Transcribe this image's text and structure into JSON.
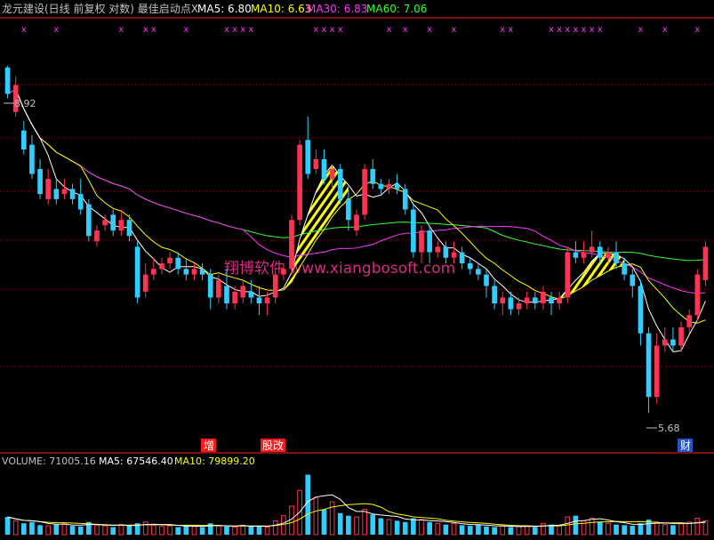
{
  "colors": {
    "background": "#000000",
    "up": "#ff3355",
    "down": "#33ccff",
    "ma5": "#ffffff",
    "ma10": "#ffff00",
    "ma30": "#ff33ff",
    "ma60": "#33ff33",
    "grid": "#a0001a",
    "border": "#ff2020",
    "hatch": "#ffff00",
    "marker": "#ff33ff",
    "watermark": "#ff3399",
    "text": "#c0c0c0",
    "label_bg": "#ff1a1a"
  },
  "header": {
    "title": "龙元建设(日线 前复权 对数) 最佳启动点X",
    "ma5_label": "MA5: 6.80",
    "ma10_label": "MA10: 6.63",
    "ma30_label": "MA30: 6.83",
    "ma60_label": "MA60: 7.06"
  },
  "volume_header": {
    "volume_label": "VOLUME: 71005.16",
    "ma5_label": "MA5: 67546.40",
    "ma10_label": "MA10: 79899.20"
  },
  "watermark": "翔博软件 www.xiangbosoft.com",
  "price_labels": {
    "high": "8.92",
    "low": "5.68"
  },
  "event_tags": [
    {
      "text": "增",
      "style": "red"
    },
    {
      "text": "股改",
      "style": "red"
    },
    {
      "text": "财",
      "style": "blue"
    }
  ],
  "chart_data": [
    {
      "type": "candlestick",
      "title": "龙元建设(日线 前复权 对数) 最佳启动点X",
      "ylim": [
        5.45,
        9.45
      ],
      "y_scale": "log",
      "annotations": {
        "high": 8.92,
        "low": 5.68
      },
      "candles": [
        [
          8.9,
          8.6,
          8.92,
          8.55
        ],
        [
          8.4,
          8.7,
          8.8,
          8.35
        ],
        [
          8.2,
          8.0,
          8.3,
          7.95
        ],
        [
          8.05,
          7.75,
          8.15,
          7.7
        ],
        [
          7.8,
          7.55,
          7.9,
          7.5
        ],
        [
          7.5,
          7.7,
          7.8,
          7.45
        ],
        [
          7.6,
          7.5,
          7.7,
          7.45
        ],
        [
          7.55,
          7.6,
          7.7,
          7.5
        ],
        [
          7.6,
          7.5,
          7.65,
          7.45
        ],
        [
          7.55,
          7.4,
          7.7,
          7.35
        ],
        [
          7.45,
          7.15,
          7.5,
          7.1
        ],
        [
          7.1,
          7.2,
          7.25,
          7.05
        ],
        [
          7.25,
          7.3,
          7.35,
          7.2
        ],
        [
          7.35,
          7.2,
          7.4,
          7.15
        ],
        [
          7.2,
          7.3,
          7.4,
          7.15
        ],
        [
          7.3,
          7.15,
          7.35,
          7.1
        ],
        [
          7.05,
          6.6,
          7.1,
          6.55
        ],
        [
          6.65,
          6.8,
          6.9,
          6.6
        ],
        [
          6.8,
          6.85,
          6.95,
          6.75
        ],
        [
          6.85,
          6.9,
          6.95,
          6.8
        ],
        [
          6.9,
          6.95,
          7.0,
          6.85
        ],
        [
          6.95,
          6.85,
          7.0,
          6.8
        ],
        [
          6.85,
          6.8,
          6.95,
          6.75
        ],
        [
          6.8,
          6.85,
          6.9,
          6.75
        ],
        [
          6.85,
          6.8,
          6.9,
          6.75
        ],
        [
          6.8,
          6.6,
          6.85,
          6.5
        ],
        [
          6.6,
          6.75,
          6.8,
          6.55
        ],
        [
          6.7,
          6.55,
          6.85,
          6.5
        ],
        [
          6.55,
          6.65,
          6.7,
          6.5
        ],
        [
          6.6,
          6.7,
          6.75,
          6.55
        ],
        [
          6.65,
          6.6,
          6.75,
          6.55
        ],
        [
          6.6,
          6.55,
          6.7,
          6.45
        ],
        [
          6.55,
          6.6,
          6.65,
          6.45
        ],
        [
          6.6,
          6.8,
          6.85,
          6.55
        ],
        [
          6.8,
          6.85,
          6.9,
          6.75
        ],
        [
          6.85,
          7.3,
          7.35,
          6.8
        ],
        [
          7.3,
          8.05,
          8.1,
          7.25
        ],
        [
          8.1,
          7.75,
          8.35,
          7.7
        ],
        [
          7.8,
          7.9,
          8.0,
          7.75
        ],
        [
          7.9,
          7.7,
          8.0,
          7.65
        ],
        [
          7.7,
          7.8,
          7.85,
          7.6
        ],
        [
          7.8,
          7.5,
          7.85,
          7.45
        ],
        [
          7.5,
          7.3,
          7.6,
          7.2
        ],
        [
          7.2,
          7.35,
          7.4,
          7.15
        ],
        [
          7.35,
          7.8,
          7.85,
          7.3
        ],
        [
          7.8,
          7.65,
          7.9,
          7.6
        ],
        [
          7.65,
          7.6,
          7.7,
          7.55
        ],
        [
          7.6,
          7.65,
          7.7,
          7.55
        ],
        [
          7.65,
          7.6,
          7.75,
          7.55
        ],
        [
          7.6,
          7.4,
          7.65,
          7.35
        ],
        [
          7.4,
          7.0,
          7.45,
          6.95
        ],
        [
          7.0,
          7.2,
          7.25,
          6.9
        ],
        [
          7.2,
          7.0,
          7.25,
          6.9
        ],
        [
          7.0,
          7.05,
          7.1,
          6.95
        ],
        [
          7.05,
          6.95,
          7.1,
          6.9
        ],
        [
          6.95,
          7.0,
          7.1,
          6.9
        ],
        [
          7.0,
          6.9,
          7.05,
          6.85
        ],
        [
          6.9,
          6.85,
          6.95,
          6.8
        ],
        [
          6.85,
          6.8,
          6.9,
          6.75
        ],
        [
          6.8,
          6.7,
          6.85,
          6.6
        ],
        [
          6.7,
          6.55,
          6.75,
          6.5
        ],
        [
          6.55,
          6.6,
          6.65,
          6.45
        ],
        [
          6.6,
          6.5,
          6.65,
          6.45
        ],
        [
          6.5,
          6.55,
          6.6,
          6.45
        ],
        [
          6.55,
          6.6,
          6.65,
          6.5
        ],
        [
          6.6,
          6.55,
          6.65,
          6.5
        ],
        [
          6.55,
          6.65,
          6.7,
          6.5
        ],
        [
          6.6,
          6.55,
          6.65,
          6.45
        ],
        [
          6.55,
          6.6,
          6.65,
          6.5
        ],
        [
          6.6,
          7.0,
          7.05,
          6.55
        ],
        [
          7.0,
          6.95,
          7.1,
          6.9
        ],
        [
          6.95,
          7.0,
          7.1,
          6.9
        ],
        [
          7.0,
          7.05,
          7.2,
          6.95
        ],
        [
          7.05,
          6.95,
          7.1,
          6.9
        ],
        [
          6.95,
          7.0,
          7.05,
          6.9
        ],
        [
          7.0,
          6.9,
          7.1,
          6.85
        ],
        [
          6.9,
          6.8,
          6.95,
          6.75
        ],
        [
          6.8,
          6.7,
          6.85,
          6.6
        ],
        [
          6.7,
          6.3,
          6.75,
          6.2
        ],
        [
          6.3,
          5.8,
          6.35,
          5.68
        ],
        [
          5.8,
          6.2,
          6.3,
          5.75
        ],
        [
          6.2,
          6.25,
          6.35,
          6.15
        ],
        [
          6.25,
          6.2,
          6.35,
          6.15
        ],
        [
          6.2,
          6.35,
          6.4,
          6.15
        ],
        [
          6.35,
          6.45,
          6.5,
          6.3
        ],
        [
          6.45,
          6.8,
          6.85,
          6.4
        ],
        [
          6.75,
          7.05,
          7.1,
          6.7
        ]
      ]
    },
    {
      "type": "bar",
      "title": "VOLUME",
      "values": [
        28,
        22,
        18,
        20,
        15,
        14,
        16,
        18,
        14,
        13,
        20,
        15,
        14,
        12,
        16,
        14,
        18,
        20,
        15,
        13,
        14,
        12,
        15,
        13,
        12,
        18,
        14,
        13,
        12,
        15,
        13,
        14,
        12,
        22,
        30,
        45,
        70,
        95,
        58,
        40,
        52,
        34,
        30,
        28,
        40,
        32,
        26,
        24,
        22,
        20,
        26,
        24,
        20,
        18,
        16,
        18,
        15,
        14,
        16,
        13,
        12,
        14,
        12,
        13,
        14,
        12,
        18,
        16,
        15,
        28,
        30,
        22,
        26,
        20,
        18,
        16,
        15,
        14,
        18,
        24,
        20,
        16,
        15,
        18,
        20,
        26,
        22
      ],
      "ylim": [
        0,
        100
      ]
    }
  ]
}
